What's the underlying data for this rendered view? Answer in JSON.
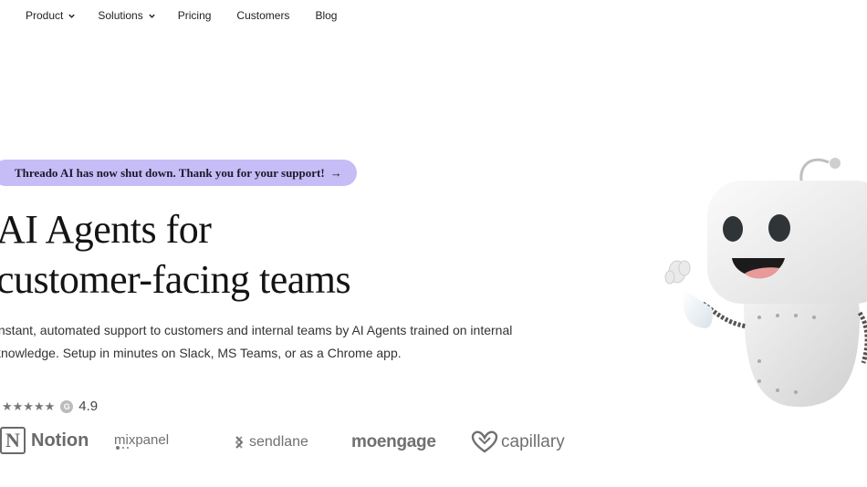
{
  "nav": {
    "items": [
      {
        "label": "Product",
        "has_dropdown": true
      },
      {
        "label": "Solutions",
        "has_dropdown": true
      },
      {
        "label": "Pricing",
        "has_dropdown": false
      },
      {
        "label": "Customers",
        "has_dropdown": false
      },
      {
        "label": "Blog",
        "has_dropdown": false
      }
    ]
  },
  "banner": {
    "text": "Threado AI has now shut down. Thank you for your support!",
    "arrow": "→",
    "color": "#c6bdf7"
  },
  "hero": {
    "headline_line1": "AI Agents for",
    "headline_line2": "customer-facing teams",
    "subtext": "Instant, automated support to customers and internal teams by AI Agents trained on internal knowledge. Setup in minutes on Slack, MS Teams, or as a Chrome app."
  },
  "rating": {
    "stars": 4.5,
    "stars_text": "★★★★★",
    "platform_icon": "g2-icon",
    "platform_letter": "G",
    "value": "4.9"
  },
  "logos": {
    "notion": {
      "mark": "N",
      "name": "Notion"
    },
    "mixpanel": {
      "name": "mixpanel"
    },
    "sendlane": {
      "name": "sendlane"
    },
    "moengage": {
      "name": "moengage"
    },
    "capillary": {
      "name": "capillary"
    }
  }
}
